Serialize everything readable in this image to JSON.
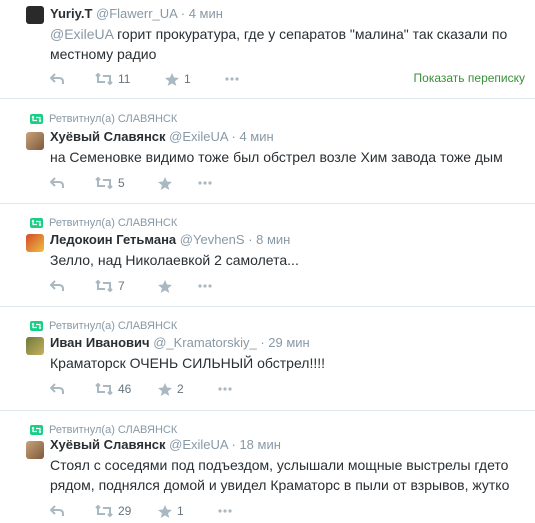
{
  "tweets": [
    {
      "rt_label": "",
      "fullname": "Yuriy.T",
      "handle": "@Flawerr_UA",
      "time": "· 4 мин",
      "mention": "@ExileUA",
      "text": " горит прокуратура, где у сепаратов \"малина\" так сказали по местному радио",
      "retweets": "11",
      "likes": "1",
      "show_conversation": "Показать переписку"
    },
    {
      "rt_label": "Ретвитнул(а) СЛАВЯНСК",
      "fullname": "Хуёвый Славянск",
      "handle": "@ExileUA",
      "time": "· 4 мин",
      "text": "на Семеновке видимо тоже был обстрел возле Хим завода тоже дым",
      "retweets": "5",
      "likes": ""
    },
    {
      "rt_label": "Ретвитнул(а) СЛАВЯНСК",
      "fullname": "Ледокоин Гетьмана",
      "handle": "@YevhenS",
      "time": "· 8 мин",
      "text": "Зелло, над Николаевкой 2 самолета...",
      "retweets": "7",
      "likes": ""
    },
    {
      "rt_label": "Ретвитнул(а) СЛАВЯНСК",
      "fullname": "Иван Иванович",
      "handle": "@_Kramatorskiy_",
      "time": "· 29 мин",
      "text": "Краматорск ОЧЕНЬ СИЛЬНЫЙ обстрел!!!!",
      "retweets": "46",
      "likes": "2"
    },
    {
      "rt_label": "Ретвитнул(а) СЛАВЯНСК",
      "fullname": "Хуёвый Славянск",
      "handle": "@ExileUA",
      "time": "· 18 мин",
      "text": "Стоял с соседями под подъездом, услышали мощные выстрелы гдето рядом, поднялся домой и увидел Краматорс в пыли от взрывов, жутко",
      "retweets": "29",
      "likes": "1"
    }
  ],
  "colors": {
    "muted": "#8899a6",
    "text": "#292f33",
    "rt_green": "#19cf86",
    "conversation_link": "#3a8f3a"
  },
  "icons": [
    "reply-icon",
    "retweet-icon",
    "favorite-icon",
    "more-icon"
  ]
}
